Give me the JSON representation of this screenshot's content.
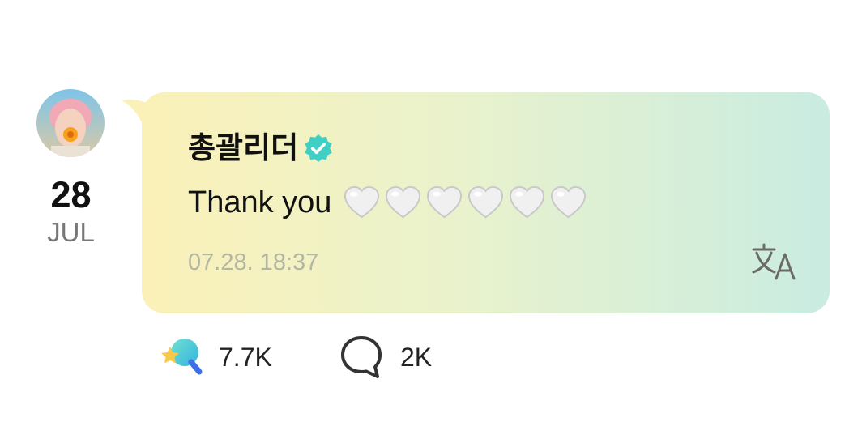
{
  "post": {
    "author": {
      "name": "총괄리더",
      "avatar_icon": "avatar-photo",
      "verified_icon": "verified-badge-icon"
    },
    "date": {
      "day": "28",
      "month": "JUL"
    },
    "message": {
      "text": "Thank you",
      "emoji": "🤍🤍🤍🤍🤍🤍",
      "emoji_count": 6
    },
    "timestamp": "07.28. 18:37",
    "translate_icon": "translate-icon"
  },
  "stats": {
    "likes": "7.7K",
    "comments": "2K",
    "like_icon": "like-star-icon",
    "comment_icon": "comment-bubble-icon"
  },
  "colors": {
    "bubble_gradient_start": "#fbf1b8",
    "bubble_gradient_mid": "#eaf2cc",
    "bubble_gradient_end": "#c9ece1",
    "verified_badge": "#3fcfc4",
    "timestamp": "#b3b6a5"
  }
}
